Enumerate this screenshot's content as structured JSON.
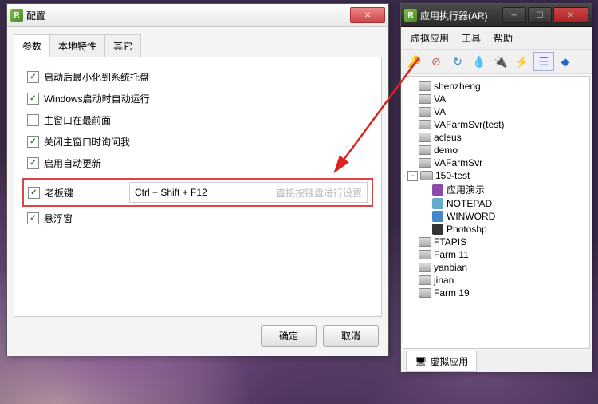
{
  "config": {
    "title": "配置",
    "tabs": {
      "params": "参数",
      "local": "本地特性",
      "other": "其它"
    },
    "opts": {
      "minimize": "启动后最小化到系统托盘",
      "autostart": "Windows启动时自动运行",
      "topmost": "主窗口在最前面",
      "askclose": "关闭主窗口时询问我",
      "autoupdate": "启用自动更新",
      "bosskey": "老板键",
      "floatwin": "悬浮窗"
    },
    "hotkey": {
      "value": "Ctrl + Shift + F12",
      "hint": "直接按键盘进行设置"
    },
    "buttons": {
      "ok": "确定",
      "cancel": "取消"
    }
  },
  "ar": {
    "title": "应用执行器(AR)",
    "menu": {
      "vapp": "虚拟应用",
      "tools": "工具",
      "help": "帮助"
    },
    "tree": [
      {
        "label": "shenzheng"
      },
      {
        "label": "VA"
      },
      {
        "label": "VA"
      },
      {
        "label": "VAFarmSvr(test)"
      },
      {
        "label": "acleus"
      },
      {
        "label": "demo"
      },
      {
        "label": "VAFarmSvr"
      },
      {
        "label": "150-test",
        "expanded": true,
        "children": [
          {
            "label": "应用演示",
            "icon": "purple"
          },
          {
            "label": "NOTEPAD",
            "icon": "note"
          },
          {
            "label": "WINWORD",
            "icon": "word"
          },
          {
            "label": "Photoshp",
            "icon": "ps"
          }
        ]
      },
      {
        "label": "FTAPIS"
      },
      {
        "label": "Farm 11"
      },
      {
        "label": "yanbian"
      },
      {
        "label": "jinan"
      },
      {
        "label": "Farm 19"
      }
    ],
    "status": "虚拟应用"
  }
}
